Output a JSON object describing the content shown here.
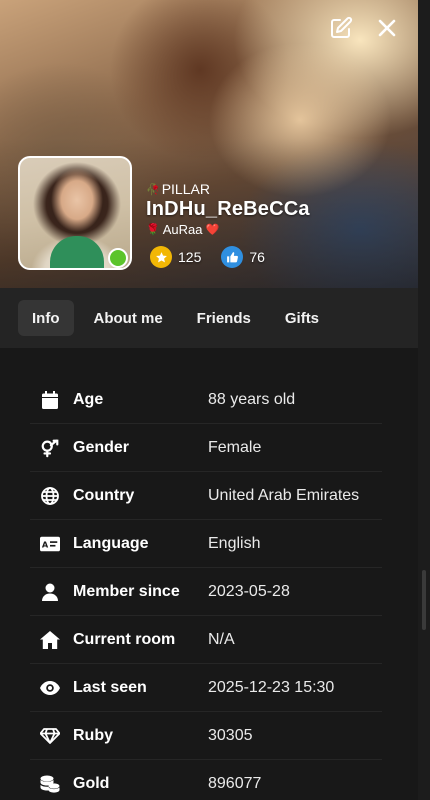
{
  "profile": {
    "tagline_prefix": "🥀",
    "tagline": "PILLAR",
    "username": "InDHu_ReBeCCa",
    "subtitle_prefix": "🌹",
    "subtitle": "AuRaa",
    "subtitle_suffix": "❤️",
    "online_status": "online",
    "stats": {
      "stars": "125",
      "likes": "76"
    }
  },
  "header_actions": {
    "edit_icon": "edit-icon",
    "close_icon": "close-icon"
  },
  "tabs": [
    {
      "label": "Info",
      "active": true
    },
    {
      "label": "About me",
      "active": false
    },
    {
      "label": "Friends",
      "active": false
    },
    {
      "label": "Gifts",
      "active": false
    }
  ],
  "info_rows": [
    {
      "icon": "calendar-icon",
      "label": "Age",
      "value": "88 years old"
    },
    {
      "icon": "gender-icon",
      "label": "Gender",
      "value": "Female"
    },
    {
      "icon": "globe-icon",
      "label": "Country",
      "value": "United Arab Emirates"
    },
    {
      "icon": "language-icon",
      "label": "Language",
      "value": "English"
    },
    {
      "icon": "user-icon",
      "label": "Member since",
      "value": "2023-05-28"
    },
    {
      "icon": "home-icon",
      "label": "Current room",
      "value": "N/A"
    },
    {
      "icon": "eye-icon",
      "label": "Last seen",
      "value": "2025-12-23 15:30"
    },
    {
      "icon": "gem-icon",
      "label": "Ruby",
      "value": "30305"
    },
    {
      "icon": "coins-icon",
      "label": "Gold",
      "value": "896077"
    }
  ],
  "colors": {
    "background": "#181818",
    "tabs_bar": "#242424",
    "active_tab": "#353535",
    "star_badge": "#f2b705",
    "like_badge": "#2f8fe0",
    "online": "#5cc42b"
  }
}
